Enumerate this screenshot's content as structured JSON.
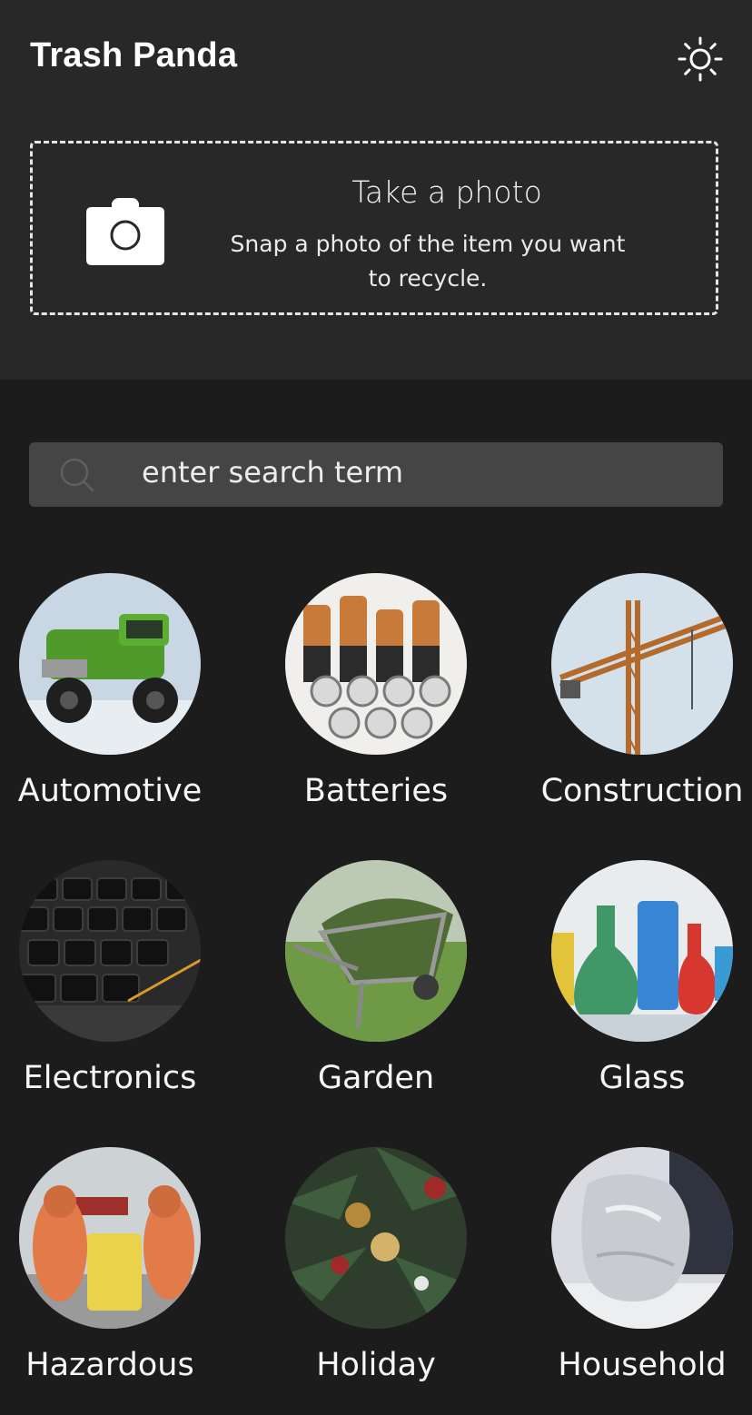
{
  "app": {
    "title": "Trash Panda"
  },
  "header": {
    "theme_icon": "sun-icon"
  },
  "photo_card": {
    "icon": "camera-icon",
    "title": "Take a photo",
    "subtitle": "Snap a photo of the item you want to recycle."
  },
  "search": {
    "icon": "search-icon",
    "placeholder": "enter search term"
  },
  "categories": [
    {
      "label": "Automotive"
    },
    {
      "label": "Batteries"
    },
    {
      "label": "Construction"
    },
    {
      "label": "Electronics"
    },
    {
      "label": "Garden"
    },
    {
      "label": "Glass"
    },
    {
      "label": "Hazardous"
    },
    {
      "label": "Holiday"
    },
    {
      "label": "Household"
    }
  ]
}
